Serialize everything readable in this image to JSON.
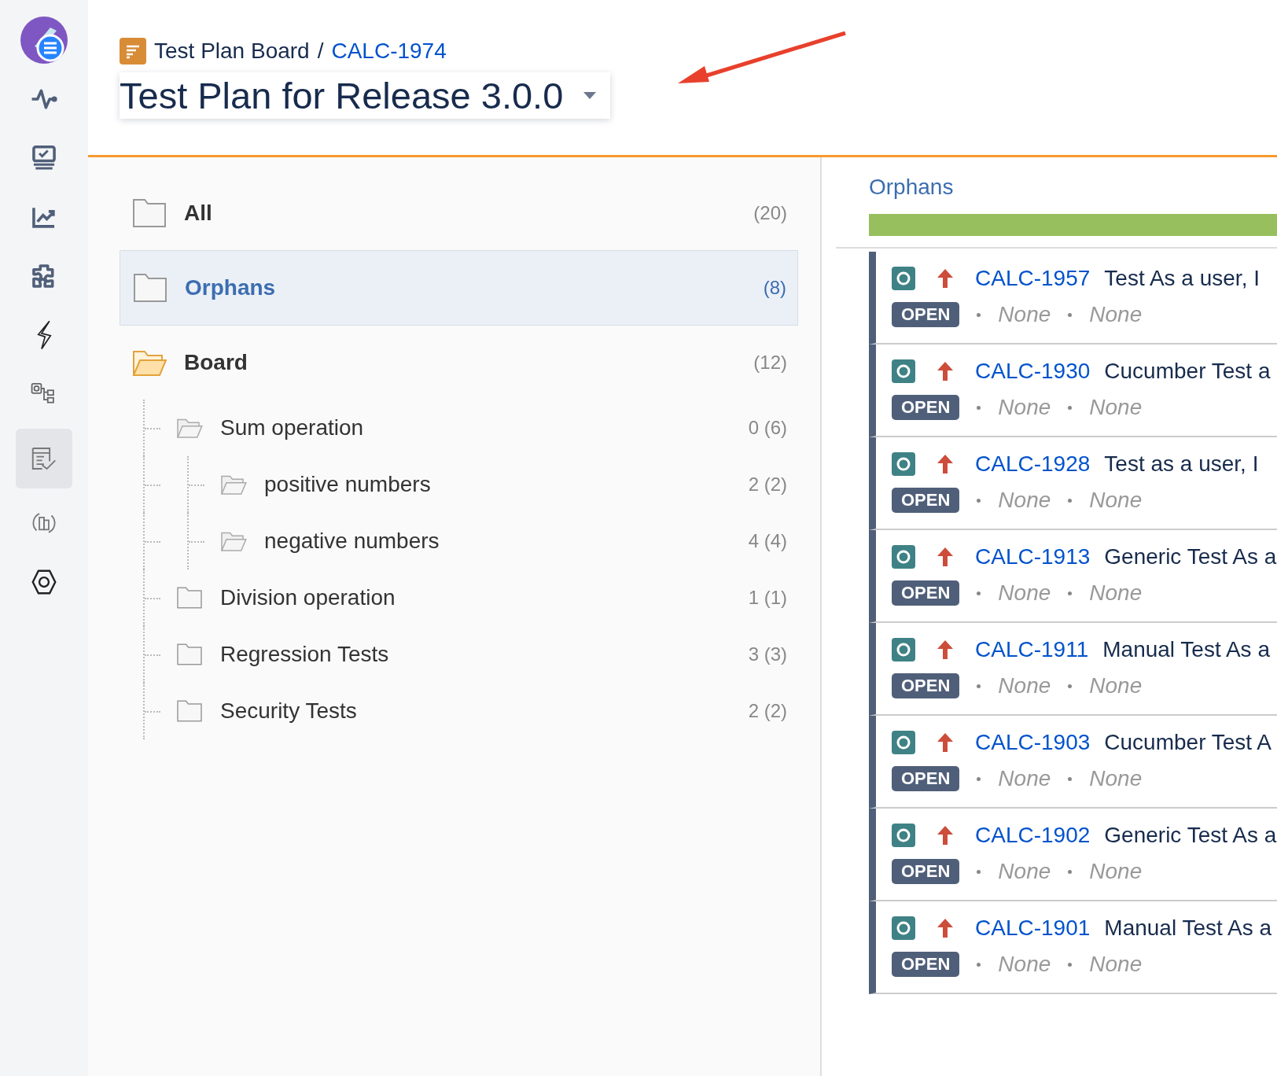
{
  "sidebar": {
    "items": [
      {
        "selected": false
      },
      {
        "selected": false
      },
      {
        "selected": false
      },
      {
        "selected": false
      },
      {
        "selected": false
      },
      {
        "selected": false
      },
      {
        "selected": false
      },
      {
        "selected": true
      },
      {
        "selected": false
      },
      {
        "selected": false
      }
    ]
  },
  "header": {
    "breadcrumb": "Test Plan Board",
    "separator": "/",
    "issue_key": "CALC-1974",
    "title": "Test Plan for Release 3.0.0"
  },
  "tree": [
    {
      "label": "All",
      "count": "(20)",
      "selected": false,
      "kind": "folder"
    },
    {
      "label": "Orphans",
      "count": "(8)",
      "selected": true,
      "kind": "folder"
    },
    {
      "label": "Board",
      "count": "(12)",
      "selected": false,
      "kind": "open-folder",
      "children": [
        {
          "label": "Sum operation",
          "count": "0 (6)",
          "selected": false,
          "kind": "open-folder",
          "children": [
            {
              "label": "positive numbers",
              "count": "2 (2)",
              "selected": false,
              "kind": "open-folder"
            },
            {
              "label": "negative numbers",
              "count": "4 (4)",
              "selected": false,
              "kind": "open-folder"
            }
          ]
        },
        {
          "label": "Division operation",
          "count": "1 (1)",
          "selected": false,
          "kind": "folder"
        },
        {
          "label": "Regression Tests",
          "count": "3 (3)",
          "selected": false,
          "kind": "folder"
        },
        {
          "label": "Security Tests",
          "count": "2 (2)",
          "selected": false,
          "kind": "folder"
        }
      ]
    }
  ],
  "panel": {
    "title": "Orphans",
    "progress": {
      "level": 1
    },
    "issues": [
      {
        "key": "CALC-1957",
        "summary": "Test As a user, I",
        "status": "OPEN",
        "fields": [
          "None",
          "None"
        ]
      },
      {
        "key": "CALC-1930",
        "summary": "Cucumber Test a",
        "status": "OPEN",
        "fields": [
          "None",
          "None"
        ]
      },
      {
        "key": "CALC-1928",
        "summary": "Test as a user, I",
        "status": "OPEN",
        "fields": [
          "None",
          "None"
        ]
      },
      {
        "key": "CALC-1913",
        "summary": "Generic Test As a",
        "status": "OPEN",
        "fields": [
          "None",
          "None"
        ]
      },
      {
        "key": "CALC-1911",
        "summary": "Manual Test As a",
        "status": "OPEN",
        "fields": [
          "None",
          "None"
        ]
      },
      {
        "key": "CALC-1903",
        "summary": "Cucumber Test A",
        "status": "OPEN",
        "fields": [
          "None",
          "None"
        ]
      },
      {
        "key": "CALC-1902",
        "summary": "Generic Test As a",
        "status": "OPEN",
        "fields": [
          "None",
          "None"
        ]
      },
      {
        "key": "CALC-1901",
        "summary": "Manual Test As a",
        "status": "OPEN",
        "fields": [
          "None",
          "None"
        ]
      }
    ]
  }
}
